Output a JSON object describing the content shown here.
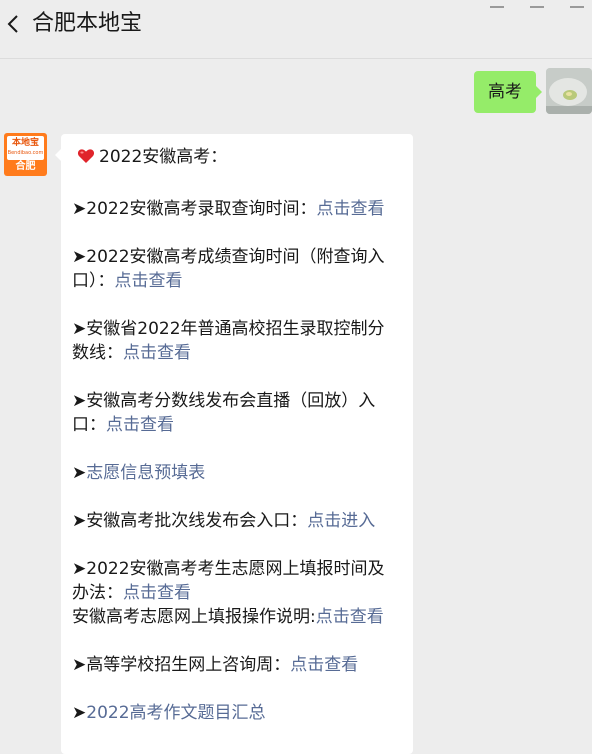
{
  "header": {
    "title": "合肥本地宝"
  },
  "outgoing": {
    "text": "高考"
  },
  "bot": {
    "logo_word": "本地宝",
    "logo_site": "Bendibao.com",
    "logo_city": "合肥"
  },
  "message": {
    "intro": "2022安徽高考：",
    "arrow": "➤",
    "items": [
      {
        "text": "2022安徽高考录取查询时间：",
        "link": "点击查看"
      },
      {
        "line1": "2022安徽高考成绩查询时间（附查询入",
        "line2": "口）：",
        "link": "点击查看"
      },
      {
        "line1": "安徽省2022年普通高校招生录取控制分",
        "line2": "数线：",
        "link": "点击查看"
      },
      {
        "line1": "安徽高考分数线发布会直播（回放）入",
        "line2": "口：",
        "link": "点击查看"
      },
      {
        "link": "志愿信息预填表"
      },
      {
        "text": "安徽高考批次线发布会入口：",
        "link": "点击进入"
      },
      {
        "line1": "2022安徽高考考生志愿网上填报时间及",
        "line2": "办法：",
        "link": "点击查看",
        "line3": "安徽高考志愿网上填报操作说明:",
        "link2": "点击查看"
      },
      {
        "text": "高等学校招生网上咨询周：",
        "link": "点击查看"
      },
      {
        "link": "2022高考作文题目汇总"
      }
    ]
  },
  "colors": {
    "outgoing_bubble": "#95ec69",
    "link": "#576b95",
    "background": "#ededed"
  }
}
